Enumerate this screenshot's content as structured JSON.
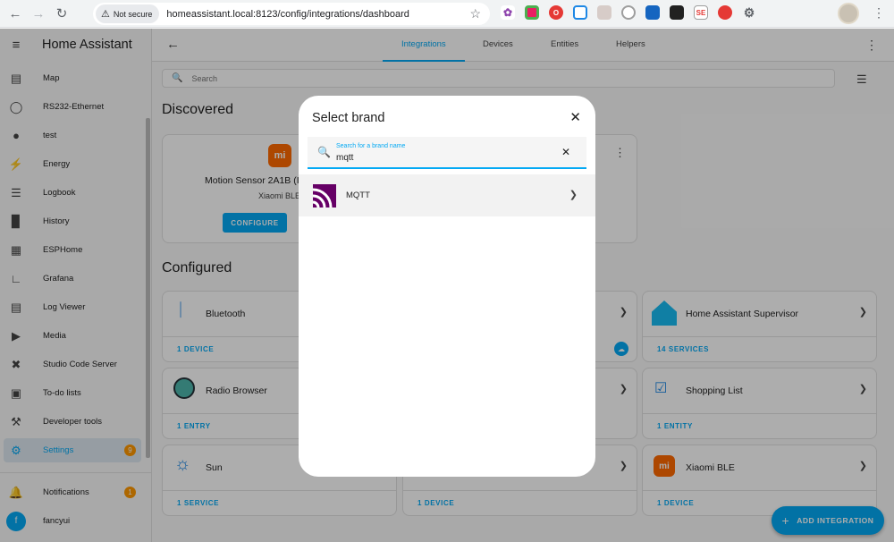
{
  "browser": {
    "security_label": "Not secure",
    "url": "homeassistant.local:8123/config/integrations/dashboard"
  },
  "sidebar": {
    "title": "Home Assistant",
    "items": [
      {
        "label": "Map",
        "icon": "map-icon"
      },
      {
        "label": "RS232-Ethernet",
        "icon": "globe-icon"
      },
      {
        "label": "test",
        "icon": "person-icon"
      },
      {
        "label": "Energy",
        "icon": "lightning-icon"
      },
      {
        "label": "Logbook",
        "icon": "list-icon"
      },
      {
        "label": "History",
        "icon": "chart-icon"
      },
      {
        "label": "ESPHome",
        "icon": "chip-icon"
      },
      {
        "label": "Grafana",
        "icon": "graph-icon"
      },
      {
        "label": "Log Viewer",
        "icon": "document-icon"
      },
      {
        "label": "Media",
        "icon": "media-icon"
      },
      {
        "label": "Studio Code Server",
        "icon": "vscode-icon"
      },
      {
        "label": "To-do lists",
        "icon": "clipboard-icon"
      },
      {
        "label": "Developer tools",
        "icon": "hammer-icon"
      },
      {
        "label": "Settings",
        "icon": "gear-icon",
        "badge": "9"
      }
    ],
    "notifications": {
      "label": "Notifications",
      "badge": "1"
    },
    "user": {
      "label": "fancyui",
      "initial": "f"
    }
  },
  "tabs": [
    "Integrations",
    "Devices",
    "Entities",
    "Helpers"
  ],
  "search": {
    "placeholder": "Search"
  },
  "discovered": {
    "title": "Discovered",
    "card": {
      "title": "Motion Sensor 2A1B (I",
      "subtitle": "Xiaomi BLE",
      "button": "CONFIGURE"
    }
  },
  "configured": {
    "title": "Configured",
    "cards": [
      {
        "title": "Bluetooth",
        "footer": "1 DEVICE"
      },
      {
        "title": "Home Assistant Supervisor",
        "footer": "14 SERVICES"
      },
      {
        "title": "Radio Browser",
        "footer": "1 ENTRY"
      },
      {
        "title": "Shopping List",
        "footer": "1 ENTITY"
      },
      {
        "title": "Sun",
        "footer": "1 SERVICE"
      },
      {
        "title": "Xiaomi BLE",
        "footer": "1 DEVICE"
      },
      {
        "footer": "1 DEVICE"
      }
    ]
  },
  "fab": {
    "label": "ADD INTEGRATION"
  },
  "dialog": {
    "title": "Select brand",
    "search_label": "Search for a brand name",
    "search_value": "mqtt",
    "results": [
      {
        "label": "MQTT"
      }
    ]
  },
  "colors": {
    "accent": "#03a9f4",
    "badge": "#ff9800",
    "mqtt": "#660066",
    "xiaomi": "#ff6900"
  }
}
